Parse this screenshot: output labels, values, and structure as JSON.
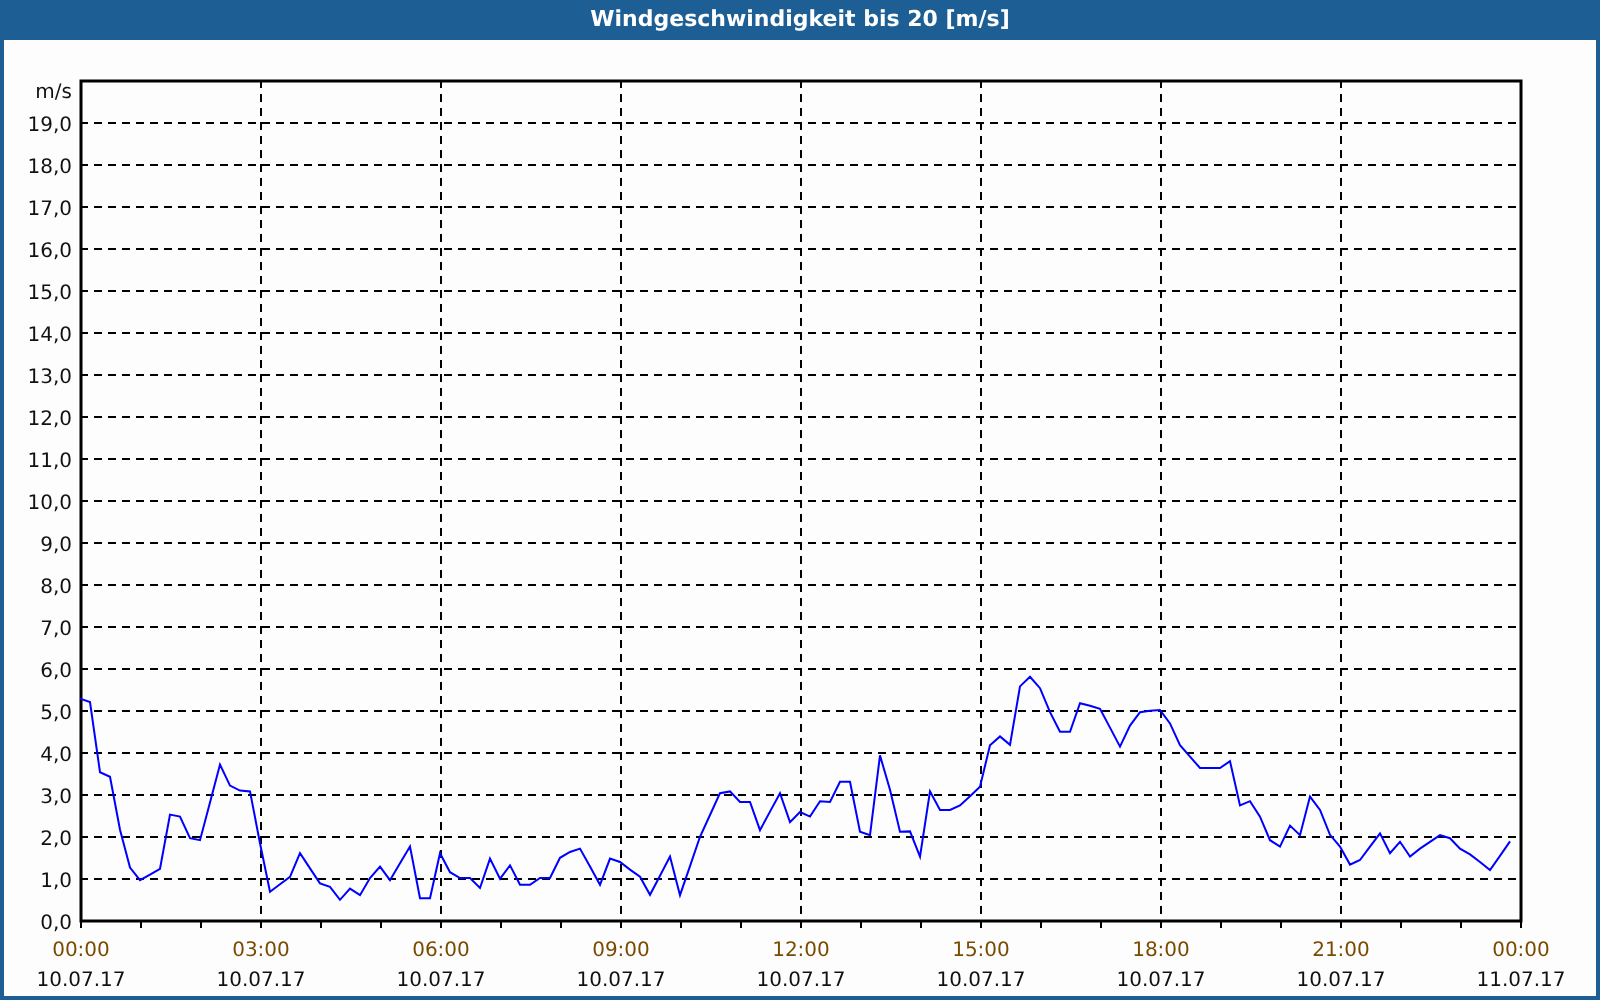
{
  "window": {
    "title": "Windgeschwindigkeit bis 20 [m/s]"
  },
  "chart": {
    "chart_data": {
      "type": "line",
      "grid": true,
      "ylabel": "m/s",
      "ylim": [
        0,
        20
      ],
      "yticks": [
        {
          "value": 0,
          "label": "0,0"
        },
        {
          "value": 1,
          "label": "1,0"
        },
        {
          "value": 2,
          "label": "2,0"
        },
        {
          "value": 3,
          "label": "3,0"
        },
        {
          "value": 4,
          "label": "4,0"
        },
        {
          "value": 5,
          "label": "5,0"
        },
        {
          "value": 6,
          "label": "6,0"
        },
        {
          "value": 7,
          "label": "7,0"
        },
        {
          "value": 8,
          "label": "8,0"
        },
        {
          "value": 9,
          "label": "9,0"
        },
        {
          "value": 10,
          "label": "10,0"
        },
        {
          "value": 11,
          "label": "11,0"
        },
        {
          "value": 12,
          "label": "12,0"
        },
        {
          "value": 13,
          "label": "13,0"
        },
        {
          "value": 14,
          "label": "14,0"
        },
        {
          "value": 15,
          "label": "15,0"
        },
        {
          "value": 16,
          "label": "16,0"
        },
        {
          "value": 17,
          "label": "17,0"
        },
        {
          "value": 18,
          "label": "18,0"
        },
        {
          "value": 19,
          "label": "19,0"
        }
      ],
      "categories": [
        "00:00 10.07.17",
        null,
        null,
        null,
        null,
        null,
        null,
        null,
        null,
        null,
        null,
        null,
        null,
        null,
        null,
        null,
        null,
        null,
        "03:00 10.07.17",
        null,
        null,
        null,
        null,
        null,
        null,
        null,
        null,
        null,
        null,
        null,
        null,
        null,
        null,
        null,
        null,
        null,
        "06:00 10.07.17",
        null,
        null,
        null,
        null,
        null,
        null,
        null,
        null,
        null,
        null,
        null,
        null,
        null,
        null,
        null,
        null,
        null,
        "09:00 10.07.17",
        null,
        null,
        null,
        null,
        null,
        null,
        null,
        null,
        null,
        null,
        null,
        null,
        null,
        null,
        null,
        null,
        null,
        "12:00 10.07.17",
        null,
        null,
        null,
        null,
        null,
        null,
        null,
        null,
        null,
        null,
        null,
        null,
        null,
        null,
        null,
        null,
        null,
        "15:00 10.07.17",
        null,
        null,
        null,
        null,
        null,
        null,
        null,
        null,
        null,
        null,
        null,
        null,
        null,
        null,
        null,
        null,
        null,
        "18:00 10.07.17",
        null,
        null,
        null,
        null,
        null,
        null,
        null,
        null,
        null,
        null,
        null,
        null,
        null,
        null,
        null,
        null,
        null,
        "21:00 10.07.17",
        null,
        null,
        null,
        null,
        null,
        null,
        null,
        null,
        null,
        null,
        null,
        null,
        null,
        null,
        null,
        null,
        null,
        "00:00 11.07.17"
      ],
      "series": [
        {
          "color": "#0000ff",
          "values": [
            5.27,
            5.19,
            3.52,
            3.41,
            2.15,
            1.25,
            0.95,
            1.08,
            1.22,
            2.51,
            2.46,
            1.95,
            1.9,
            2.8,
            3.7,
            3.2,
            3.08,
            3.06,
            1.83,
            0.67,
            0.85,
            1.03,
            1.59,
            1.23,
            0.87,
            0.79,
            0.48,
            0.75,
            0.59,
            1.0,
            1.27,
            0.95,
            1.35,
            1.75,
            0.52,
            0.52,
            1.59,
            1.14,
            1.0,
            1.0,
            0.76,
            1.46,
            0.98,
            1.3,
            0.84,
            0.84,
            1.0,
            1.0,
            1.48,
            1.62,
            1.7,
            1.27,
            0.84,
            1.46,
            1.38,
            1.2,
            1.03,
            0.6,
            1.05,
            1.51,
            0.59,
            1.28,
            1.98,
            2.5,
            3.02,
            3.06,
            2.81,
            2.81,
            2.14,
            2.58,
            3.02,
            2.33,
            2.57,
            2.46,
            2.83,
            2.81,
            3.29,
            3.29,
            2.1,
            2.02,
            3.92,
            3.1,
            2.1,
            2.11,
            1.51,
            3.06,
            2.62,
            2.62,
            2.73,
            2.95,
            3.17,
            4.16,
            4.37,
            4.17,
            5.56,
            5.79,
            5.52,
            4.95,
            4.48,
            4.48,
            5.16,
            5.1,
            5.03,
            4.58,
            4.13,
            4.63,
            4.95,
            4.98,
            5.0,
            4.68,
            4.16,
            3.89,
            3.62,
            3.62,
            3.62,
            3.78,
            2.73,
            2.83,
            2.46,
            1.9,
            1.75,
            2.25,
            2.02,
            2.94,
            2.62,
            2.03,
            1.75,
            1.32,
            1.43,
            1.75,
            2.06,
            1.59,
            1.86,
            1.51,
            1.7,
            1.86,
            2.02,
            1.95,
            1.7,
            1.56,
            1.38,
            1.19,
            1.53,
            1.87,
            null
          ]
        }
      ]
    }
  }
}
